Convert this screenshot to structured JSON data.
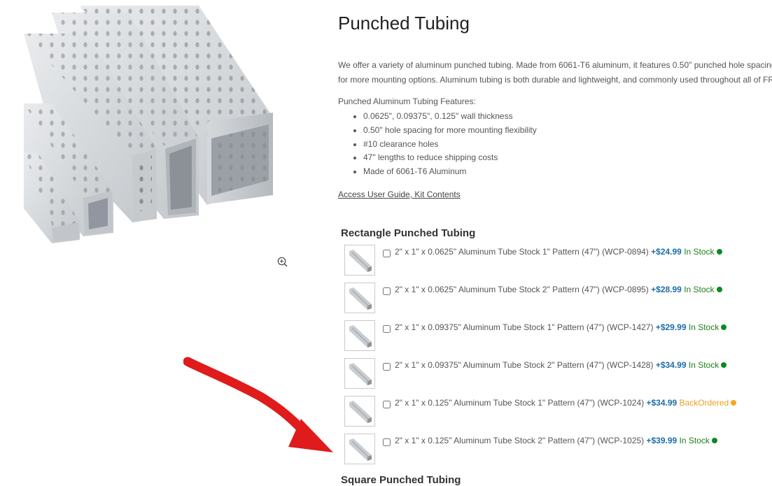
{
  "product": {
    "title": "Punched Tubing",
    "description": "We offer a variety of aluminum punched tubing. Made from 6061-T6 aluminum, it features 0.50\" punched hole spacing for more mounting options. Aluminum tubing is both durable and lightweight, and commonly used throughout all of FRC.",
    "features_heading": "Punched Aluminum Tubing Features:",
    "features": [
      "0.0625\", 0.09375\", 0.125\" wall thickness",
      "0.50\" hole spacing for more mounting flexibility",
      "#10 clearance holes",
      "47\" lengths to reduce shipping costs",
      "Made of 6061-T6 Aluminum"
    ],
    "guide_link": "Access User Guide, Kit Contents"
  },
  "sections": {
    "rectangle": {
      "heading": "Rectangle Punched Tubing",
      "options": [
        {
          "name": "2\" x 1\" x 0.0625\" Aluminum Tube Stock 1\" Pattern (47\") (WCP-0894)",
          "price": "+$24.99",
          "stock": "In Stock",
          "status": "in-stock",
          "checked": false
        },
        {
          "name": "2\" x 1\" x 0.0625\" Aluminum Tube Stock 2\" Pattern (47\") (WCP-0895)",
          "price": "+$28.99",
          "stock": "In Stock",
          "status": "in-stock",
          "checked": false
        },
        {
          "name": "2\" x 1\" x 0.09375\" Aluminum Tube Stock 1\" Pattern (47\") (WCP-1427)",
          "price": "+$29.99",
          "stock": "In Stock",
          "status": "in-stock",
          "checked": false
        },
        {
          "name": "2\" x 1\" x 0.09375\" Aluminum Tube Stock 2\" Pattern (47\") (WCP-1428)",
          "price": "+$34.99",
          "stock": "In Stock",
          "status": "in-stock",
          "checked": false
        },
        {
          "name": "2\" x 1\" x 0.125\" Aluminum Tube Stock 1\" Pattern (47\") (WCP-1024)",
          "price": "+$34.99",
          "stock": "BackOrdered",
          "status": "backordered",
          "checked": false
        },
        {
          "name": "2\" x 1\" x 0.125\" Aluminum Tube Stock 2\" Pattern (47\") (WCP-1025)",
          "price": "+$39.99",
          "stock": "In Stock",
          "status": "in-stock",
          "checked": false
        }
      ]
    },
    "square": {
      "heading": "Square Punched Tubing"
    }
  },
  "icons": {
    "zoom": "zoom-in-icon",
    "stock_in": "green-status-dot",
    "stock_backordered": "orange-status-dot"
  },
  "colors": {
    "price": "#1d6ea8",
    "in_stock": "#1e7e1e",
    "backordered": "#f0a020",
    "annotation_arrow": "#e01b1b"
  }
}
